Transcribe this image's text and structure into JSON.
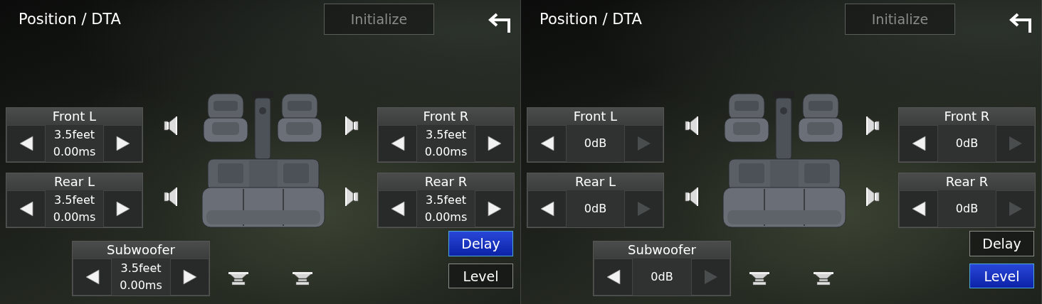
{
  "screens": [
    {
      "title": "Position / DTA",
      "initialize": {
        "label": "Initialize",
        "disabled": true
      },
      "controls": [
        {
          "label": "Front L",
          "value_lines": [
            "3.5feet",
            "0.00ms"
          ],
          "decrease_disabled": false,
          "increase_disabled": false
        },
        {
          "label": "Front R",
          "value_lines": [
            "3.5feet",
            "0.00ms"
          ],
          "decrease_disabled": false,
          "increase_disabled": false
        },
        {
          "label": "Rear L",
          "value_lines": [
            "3.5feet",
            "0.00ms"
          ],
          "decrease_disabled": false,
          "increase_disabled": false
        },
        {
          "label": "Rear R",
          "value_lines": [
            "3.5feet",
            "0.00ms"
          ],
          "decrease_disabled": false,
          "increase_disabled": false
        },
        {
          "label": "Subwoofer",
          "value_lines": [
            "3.5feet",
            "0.00ms"
          ],
          "decrease_disabled": false,
          "increase_disabled": false
        }
      ],
      "modes": [
        {
          "label": "Delay",
          "selected": true
        },
        {
          "label": "Level",
          "selected": false
        }
      ]
    },
    {
      "title": "Position / DTA",
      "initialize": {
        "label": "Initialize",
        "disabled": true
      },
      "controls": [
        {
          "label": "Front L",
          "value_lines": [
            "0dB"
          ],
          "decrease_disabled": false,
          "increase_disabled": true
        },
        {
          "label": "Front R",
          "value_lines": [
            "0dB"
          ],
          "decrease_disabled": false,
          "increase_disabled": true
        },
        {
          "label": "Rear L",
          "value_lines": [
            "0dB"
          ],
          "decrease_disabled": false,
          "increase_disabled": true
        },
        {
          "label": "Rear R",
          "value_lines": [
            "0dB"
          ],
          "decrease_disabled": false,
          "increase_disabled": true
        },
        {
          "label": "Subwoofer",
          "value_lines": [
            "0dB"
          ],
          "decrease_disabled": false,
          "increase_disabled": true
        }
      ],
      "modes": [
        {
          "label": "Delay",
          "selected": false
        },
        {
          "label": "Level",
          "selected": true
        }
      ]
    }
  ]
}
